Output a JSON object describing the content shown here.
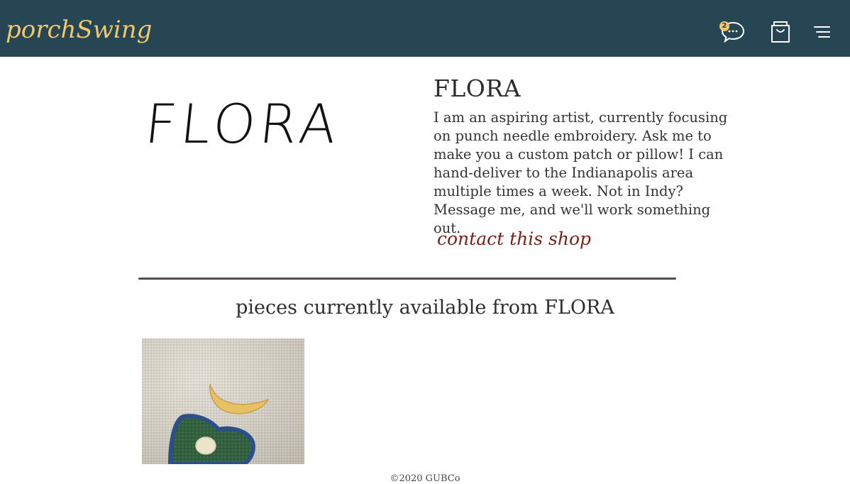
{
  "header": {
    "brand": "porchSwing",
    "message_badge_count": "2",
    "icons": [
      "chat-bubble-icon",
      "shopping-bag-icon",
      "hamburger-menu-icon"
    ],
    "colors": {
      "nav_background": "#264653",
      "brand_accent": "#f1c76e"
    }
  },
  "shop": {
    "logo_text": "FLORA",
    "name": "FLORA",
    "bio": "I am an aspiring artist, currently focusing on punch needle embroidery. Ask me to make you a custom patch or pillow! I can hand-deliver to the Indianapolis area multiple times a week. Not in Indy? Message me, and we'll work something out.",
    "contact_label": "contact this shop",
    "contact_color": "#7b1f14"
  },
  "pieces": {
    "heading": "pieces currently available from FLORA",
    "items": [
      {
        "image": "punch-needle-embroidery-photo"
      }
    ]
  },
  "footer": {
    "copyright": "©2020 GUBCo"
  }
}
